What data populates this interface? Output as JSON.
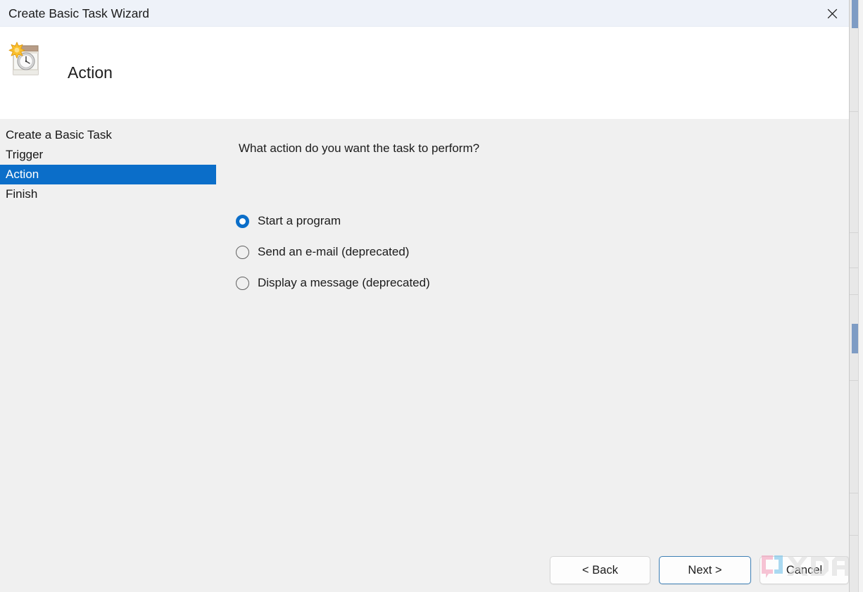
{
  "window": {
    "title": "Create Basic Task Wizard",
    "close_icon": "close-icon"
  },
  "header": {
    "icon": "task-scheduler-calendar-clock-icon",
    "title": "Action"
  },
  "sidebar": {
    "steps": [
      {
        "label": "Create a Basic Task",
        "current": false
      },
      {
        "label": "Trigger",
        "current": false
      },
      {
        "label": "Action",
        "current": true
      },
      {
        "label": "Finish",
        "current": false
      }
    ]
  },
  "main": {
    "question": "What action do you want the task to perform?",
    "options": [
      {
        "label": "Start a program",
        "selected": true
      },
      {
        "label": "Send an e-mail (deprecated)",
        "selected": false
      },
      {
        "label": "Display a message (deprecated)",
        "selected": false
      }
    ]
  },
  "footer": {
    "back_label": "< Back",
    "next_label": "Next >",
    "cancel_label": "Cancel"
  },
  "watermark": {
    "name": "xda-logo-watermark",
    "text": "XDA"
  },
  "colors": {
    "accent": "#0b6ec9",
    "titlebar": "#eef2f9",
    "body": "#f0f0f0",
    "header": "#ffffff",
    "default_button_border": "#3e7fb5",
    "watermark_pink": "#f2a0bc",
    "watermark_blue": "#78c4ea"
  }
}
